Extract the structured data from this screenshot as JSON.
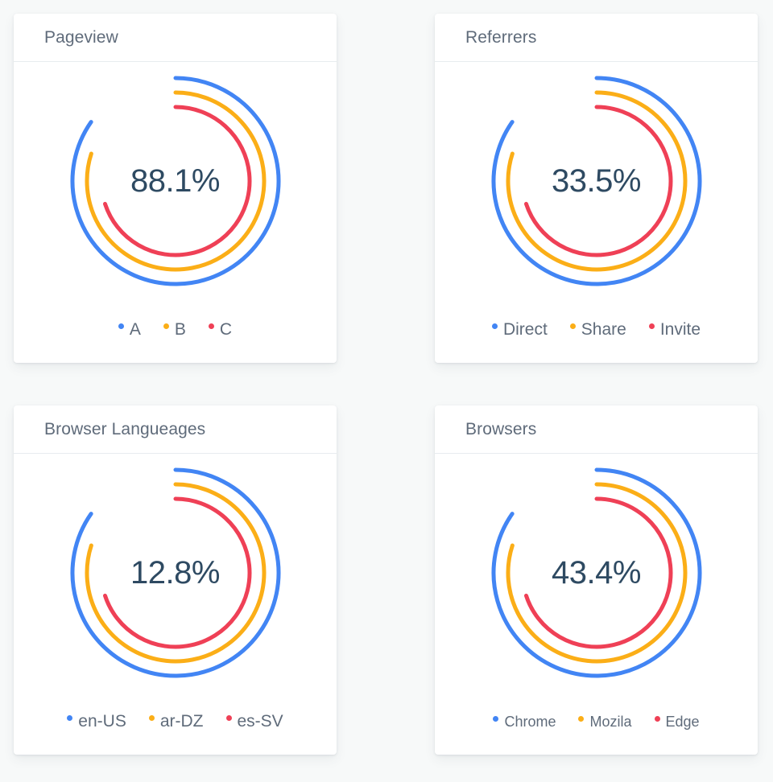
{
  "theme": {
    "page_background": "#f7f9f9",
    "card_background": "#ffffff",
    "title_color": "#5f6b7a",
    "value_color": "#2e4a62",
    "series_colors": {
      "blue": "#4285f4",
      "orange": "#fbae17",
      "red": "#ef4056"
    }
  },
  "cards": [
    {
      "title": "Pageview",
      "value": "88.1%",
      "legend": [
        {
          "label": "A",
          "color": "#4285f4",
          "dot": "legend-dot-blue"
        },
        {
          "label": "B",
          "color": "#fbae17",
          "dot": "legend-dot-orange"
        },
        {
          "label": "C",
          "color": "#ef4056",
          "dot": "legend-dot-red"
        }
      ]
    },
    {
      "title": "Referrers",
      "value": "33.5%",
      "legend": [
        {
          "label": "Direct",
          "color": "#4285f4",
          "dot": "legend-dot-blue"
        },
        {
          "label": "Share",
          "color": "#fbae17",
          "dot": "legend-dot-orange"
        },
        {
          "label": "Invite",
          "color": "#ef4056",
          "dot": "legend-dot-red"
        }
      ]
    },
    {
      "title": "Browser Langueages",
      "value": "12.8%",
      "legend": [
        {
          "label": "en-US",
          "color": "#4285f4",
          "dot": "legend-dot-blue"
        },
        {
          "label": "ar-DZ",
          "color": "#fbae17",
          "dot": "legend-dot-orange"
        },
        {
          "label": "es-SV",
          "color": "#ef4056",
          "dot": "legend-dot-red"
        }
      ]
    },
    {
      "title": "Browsers",
      "value": "43.4%",
      "legend": [
        {
          "label": "Chrome",
          "color": "#4285f4",
          "dot": "legend-dot-blue"
        },
        {
          "label": "Mozila",
          "color": "#fbae17",
          "dot": "legend-dot-orange"
        },
        {
          "label": "Edge",
          "color": "#ef4056",
          "dot": "legend-dot-red"
        }
      ]
    }
  ],
  "chart_data": [
    {
      "type": "pie",
      "title": "Pageview",
      "center_label": "88.1%",
      "legend_position": "bottom",
      "series": [
        {
          "name": "A",
          "color": "#4285f4",
          "ring": "outer",
          "radius": 128,
          "sweep_degrees": 305,
          "start_degrees": 0
        },
        {
          "name": "B",
          "color": "#fbae17",
          "ring": "middle",
          "radius": 110,
          "sweep_degrees": 288,
          "start_degrees": 0
        },
        {
          "name": "C",
          "color": "#ef4056",
          "ring": "inner",
          "radius": 92,
          "sweep_degrees": 252,
          "start_degrees": 0
        }
      ]
    },
    {
      "type": "pie",
      "title": "Referrers",
      "center_label": "33.5%",
      "legend_position": "bottom",
      "series": [
        {
          "name": "Direct",
          "color": "#4285f4",
          "ring": "outer",
          "radius": 128,
          "sweep_degrees": 305,
          "start_degrees": 0
        },
        {
          "name": "Share",
          "color": "#fbae17",
          "ring": "middle",
          "radius": 110,
          "sweep_degrees": 288,
          "start_degrees": 0
        },
        {
          "name": "Invite",
          "color": "#ef4056",
          "ring": "inner",
          "radius": 92,
          "sweep_degrees": 252,
          "start_degrees": 0
        }
      ]
    },
    {
      "type": "pie",
      "title": "Browser Langueages",
      "center_label": "12.8%",
      "legend_position": "bottom",
      "series": [
        {
          "name": "en-US",
          "color": "#4285f4",
          "ring": "outer",
          "radius": 128,
          "sweep_degrees": 305,
          "start_degrees": 0
        },
        {
          "name": "ar-DZ",
          "color": "#fbae17",
          "ring": "middle",
          "radius": 110,
          "sweep_degrees": 288,
          "start_degrees": 0
        },
        {
          "name": "es-SV",
          "color": "#ef4056",
          "ring": "inner",
          "radius": 92,
          "sweep_degrees": 252,
          "start_degrees": 0
        }
      ]
    },
    {
      "type": "pie",
      "title": "Browsers",
      "center_label": "43.4%",
      "legend_position": "bottom",
      "series": [
        {
          "name": "Chrome",
          "color": "#4285f4",
          "ring": "outer",
          "radius": 128,
          "sweep_degrees": 305,
          "start_degrees": 0
        },
        {
          "name": "Mozila",
          "color": "#fbae17",
          "ring": "middle",
          "radius": 110,
          "sweep_degrees": 288,
          "start_degrees": 0
        },
        {
          "name": "Edge",
          "color": "#ef4056",
          "ring": "inner",
          "radius": 92,
          "sweep_degrees": 252,
          "start_degrees": 0
        }
      ]
    }
  ]
}
